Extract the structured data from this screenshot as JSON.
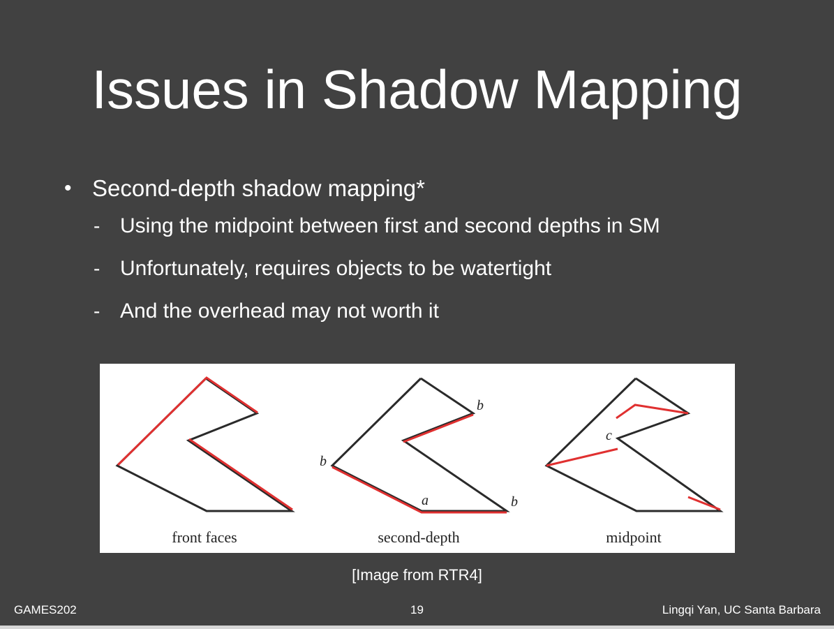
{
  "slide": {
    "title": "Issues in Shadow Mapping",
    "bullet": {
      "text": "Second-depth shadow mapping*",
      "subitems": [
        "Using the midpoint between first and second depths in SM",
        "Unfortunately, requires objects to be watertight",
        "And the overhead may not worth it"
      ]
    },
    "figure": {
      "panels": [
        {
          "caption": "front faces"
        },
        {
          "caption": "second-depth",
          "labels": [
            "b",
            "b",
            "a",
            "b"
          ]
        },
        {
          "caption": "midpoint",
          "labels": [
            "c"
          ]
        }
      ]
    },
    "caption": "[Image from RTR4]"
  },
  "footer": {
    "left": "GAMES202",
    "page": "19",
    "right": "Lingqi Yan, UC Santa Barbara"
  },
  "colors": {
    "background": "#414141",
    "text": "#ffffff",
    "figure_stroke": "#2a2a2a",
    "highlight": "#e03030"
  }
}
